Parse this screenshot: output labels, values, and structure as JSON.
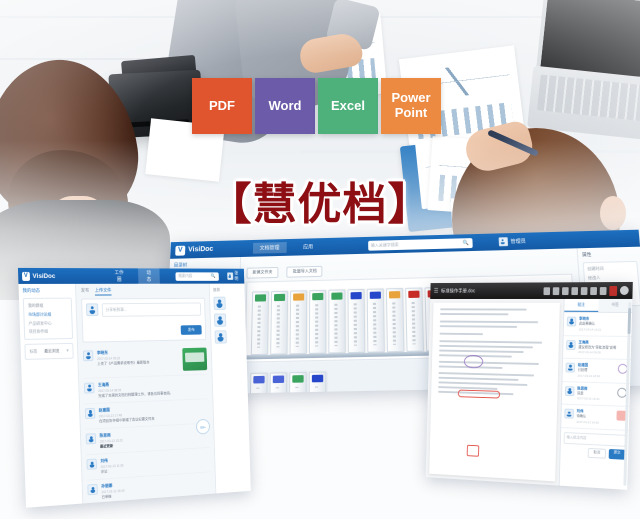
{
  "hero": {
    "title": "【慧优档】",
    "title_color": "#8d0f14",
    "format_tiles": [
      {
        "label": "PDF",
        "color": "#e0542e",
        "name": "tile-pdf"
      },
      {
        "label": "Word",
        "color": "#6b5ba8",
        "name": "tile-word"
      },
      {
        "label": "Excel",
        "color": "#4eb17c",
        "name": "tile-excel"
      },
      {
        "label": "Power\nPoint",
        "color": "#ed8a42",
        "name": "tile-powerpoint"
      }
    ]
  },
  "center_window": {
    "brand": "VisiDoc",
    "logo_letter": "V",
    "nav": [
      {
        "label": "文档管理",
        "active": true
      },
      {
        "label": "应用"
      }
    ],
    "search_placeholder": "输入关键字搜索",
    "user_label": "管理员",
    "toolbar_chips": [
      "新建文件夹",
      "批量导入文档"
    ],
    "left_panel_title": "目录树",
    "right_panel_title": "属性",
    "right_panel_fields": [
      "创建时间",
      "修改人",
      "大小",
      "版本号"
    ],
    "binder_rows": [
      {
        "tabs": [
          "#3aa45f",
          "#3aa45f",
          "#e8a33d",
          "#3aa45f",
          "#3aa45f",
          "#2647c9",
          "#2647c9",
          "#e8a33d",
          "#c62b26",
          "#c62b26",
          "#c62b26"
        ]
      },
      {
        "tabs": [
          "#4a64d8",
          "#4a64d8",
          "#3aa45f",
          "#2647c9"
        ]
      }
    ]
  },
  "left_window": {
    "brand": "VisiDoc",
    "logo_letter": "V",
    "nav": [
      {
        "label": "工作圈",
        "active": false
      },
      {
        "label": "动态",
        "active": true
      }
    ],
    "search_placeholder": "搜索内容",
    "user_label": "张明",
    "sidebar_title": "我的动态",
    "group_title": "我的群组",
    "group_items": [
      "市场部讨论组",
      "产品研发中心",
      "项目协作组"
    ],
    "sidebar_footer_label": "标签",
    "sidebar_footer_value": "最近浏览",
    "composer_tabs": [
      "发布",
      "上传文件"
    ],
    "composer_placeholder": "分享新鲜事...",
    "composer_button": "发布",
    "posts": [
      {
        "author": "李晓东",
        "time": "2017-03-14 09:32",
        "text": "上传了《产品需求说明书》最新版本",
        "has_thumb": true
      },
      {
        "author": "王海燕",
        "time": "2017-03-14 08:15",
        "text": "完成了本周的文档归档整理工作，请各位同事查阅。"
      },
      {
        "author": "赵建国",
        "time": "2017-03-13 17:48",
        "text": "在项目协作组中新增了会议纪要文件夹"
      },
      {
        "author": "陈思雨",
        "time": "2017-03-13 15:20",
        "text": "最近更新",
        "highlight": true
      },
      {
        "author": "刘伟",
        "time": "2017-03-13 11:05",
        "text": "评论"
      },
      {
        "author": "孙丽娜",
        "time": "2017-03-12 16:40",
        "text": "已审核"
      }
    ],
    "right_panel_title": "推荐",
    "badge_value": "99+"
  },
  "right_window": {
    "title": "标准操作手册.doc",
    "tools": [
      "select-tool",
      "text-tool",
      "hand-tool",
      "zoom-tool",
      "highlight-tool",
      "pen-tool",
      "stamp-tool",
      "color-swatch",
      "close-button"
    ],
    "sidebar_tabs": [
      "批注",
      "书签"
    ],
    "active_sidebar_tab": "批注",
    "comments": [
      {
        "author": "李晓东",
        "text": "此处需确认",
        "time": "2017-03-14 10:21"
      },
      {
        "author": "王海燕",
        "text": "建议修改为\"审批流程\"说明",
        "time": "2017-03-14 09:58"
      },
      {
        "author": "赵建国",
        "text": "已处理",
        "time": "2017-03-13 18:02",
        "mark": "stamp"
      },
      {
        "author": "陈思雨",
        "text": "同意",
        "time": "2017-03-13 16:44",
        "mark": "approved"
      },
      {
        "author": "刘伟",
        "text": "待确认",
        "time": "2017-03-13 14:09",
        "mark": "flag"
      }
    ],
    "reply_placeholder": "输入批注内容",
    "reply_buttons": [
      "取消",
      "提交"
    ]
  }
}
